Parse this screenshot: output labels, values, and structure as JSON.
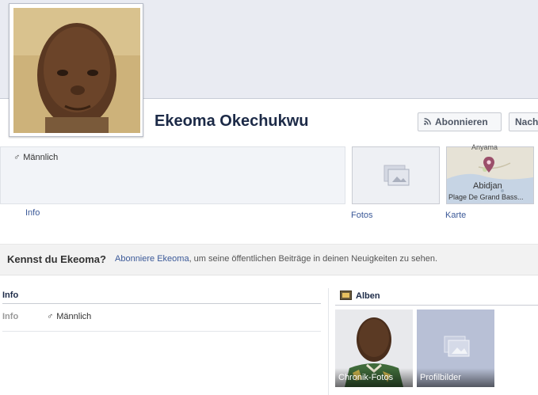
{
  "profile": {
    "name": "Ekeoma Okechukwu",
    "gender": "Männlich"
  },
  "buttons": {
    "follow": "Abonnieren",
    "message": "Nach"
  },
  "tabs": {
    "info": "Info",
    "photos": "Fotos",
    "map": "Karte"
  },
  "map": {
    "place_top": "Anyama",
    "city": "Abidjan",
    "place_bottom": "Plage De Grand Bass..."
  },
  "follow_strip": {
    "title": "Kennst du Ekeoma?",
    "link": "Abonniere Ekeoma",
    "text": ", um seine öffentlichen Beiträge in deinen Neuigkeiten zu sehen."
  },
  "info_section": {
    "heading": "Info",
    "row_label": "Info",
    "row_value": "Männlich"
  },
  "albums_section": {
    "heading": "Alben",
    "items": [
      {
        "label": "Chronik-Fotos"
      },
      {
        "label": "Profilbilder"
      }
    ]
  },
  "colors": {
    "link": "#3b5998",
    "name": "#1c2a47",
    "map_pin": "#9b4f6a"
  }
}
